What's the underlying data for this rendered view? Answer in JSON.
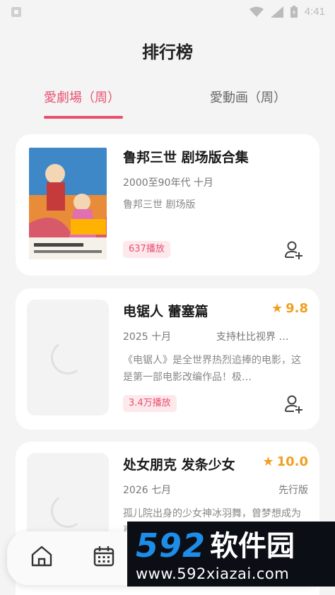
{
  "status_bar": {
    "time": "4:41",
    "icons": [
      "app-icon",
      "wifi-icon",
      "signal-icon",
      "battery-icon"
    ]
  },
  "page": {
    "title": "排行榜"
  },
  "tabs": [
    {
      "label": "愛劇場（周）",
      "active": true
    },
    {
      "label": "愛動画（周）",
      "active": false
    }
  ],
  "cards": [
    {
      "title": "鲁邦三世 剧场版合集",
      "meta": "2000至90年代  十月",
      "description": "鲁邦三世 剧场版",
      "plays": "637播放",
      "has_poster": true
    },
    {
      "title": "电锯人 蕾塞篇",
      "rating": "9.8",
      "meta": "2025  十月",
      "meta_extra": "支持杜比视界 …",
      "description": "《电锯人》是全世界热烈追捧的电影，这是第一部电影改编作品！极…",
      "plays": "3.4万播放",
      "has_poster": false
    },
    {
      "title": "处女朋克 发条少女",
      "rating": "10.0",
      "meta": "2026  七月",
      "meta_extra": "先行版",
      "description": "孤儿院出身的少女神冰羽舞，曾梦想成为声望赫赫不同凡响，如今在铭…",
      "has_poster": false
    }
  ],
  "bottom_nav": {
    "items": [
      "home-icon",
      "calendar-icon"
    ]
  },
  "watermark": {
    "number": "592",
    "name": "软件园",
    "url": "www.592xiazai.com"
  },
  "colors": {
    "accent": "#e8516f",
    "rating": "#f0a020",
    "badge_bg": "#fde8ec"
  }
}
